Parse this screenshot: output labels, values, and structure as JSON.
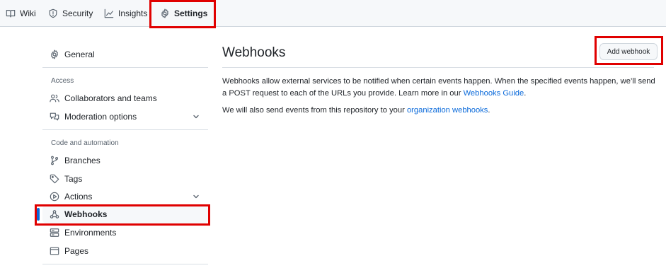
{
  "nav": {
    "tabs": [
      {
        "label": "Wiki",
        "icon": "book-icon"
      },
      {
        "label": "Security",
        "icon": "shield-icon"
      },
      {
        "label": "Insights",
        "icon": "graph-icon"
      },
      {
        "label": "Settings",
        "icon": "gear-icon",
        "selected": true
      }
    ]
  },
  "sidebar": {
    "general": "General",
    "access_heading": "Access",
    "collaborators": "Collaborators and teams",
    "moderation": "Moderation options",
    "code_heading": "Code and automation",
    "branches": "Branches",
    "tags": "Tags",
    "actions": "Actions",
    "webhooks": "Webhooks",
    "environments": "Environments",
    "pages": "Pages",
    "active_item": "Webhooks"
  },
  "main": {
    "title": "Webhooks",
    "add_button": "Add webhook",
    "description_part1": "Webhooks allow external services to be notified when certain events happen. When the specified events happen, we’ll send a POST request to each of the URLs you provide. Learn more in our ",
    "description_link": "Webhooks Guide",
    "description_end": ".",
    "org_part1": "We will also send events from this repository to your ",
    "org_link": "organization webhooks",
    "org_end": "."
  },
  "colors": {
    "accent_link": "#0969da",
    "selected_underline": "#fd8c73",
    "annotation_red": "#e00000"
  }
}
